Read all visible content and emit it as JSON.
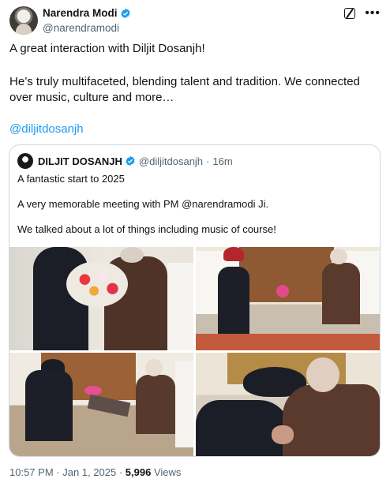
{
  "tweet": {
    "display_name": "Narendra Modi",
    "handle": "@narendramodi",
    "paragraphs": [
      "A great interaction with Diljit Dosanjh!",
      "He’s truly multifaceted, blending talent and tradition. We connected over music, culture and more…"
    ],
    "mention": "@diljitdosanjh",
    "icons": {
      "verified": "verified-badge-icon",
      "grok": "grok-icon",
      "more": "more-icon"
    }
  },
  "quote": {
    "display_name": "DILJIT DOSANJH",
    "handle": "@diljitdosanjh",
    "time": "16m",
    "lines": [
      "A fantastic start to 2025",
      "A very memorable meeting with PM @narendramodi Ji.",
      "We talked about a lot of things including music of course!"
    ],
    "photos": [
      "photo-bouquet-handover",
      "photo-seated-conversation",
      "photo-seated-greeting",
      "photo-blessing-embrace"
    ]
  },
  "footer": {
    "time": "10:57 PM",
    "date": "Jan 1, 2025",
    "views_count": "5,996",
    "views_label": "Views"
  },
  "colors": {
    "link": "#1d9bf0",
    "verified": "#1d9bf0",
    "secondary_text": "#536471",
    "border": "#cfd9de"
  }
}
